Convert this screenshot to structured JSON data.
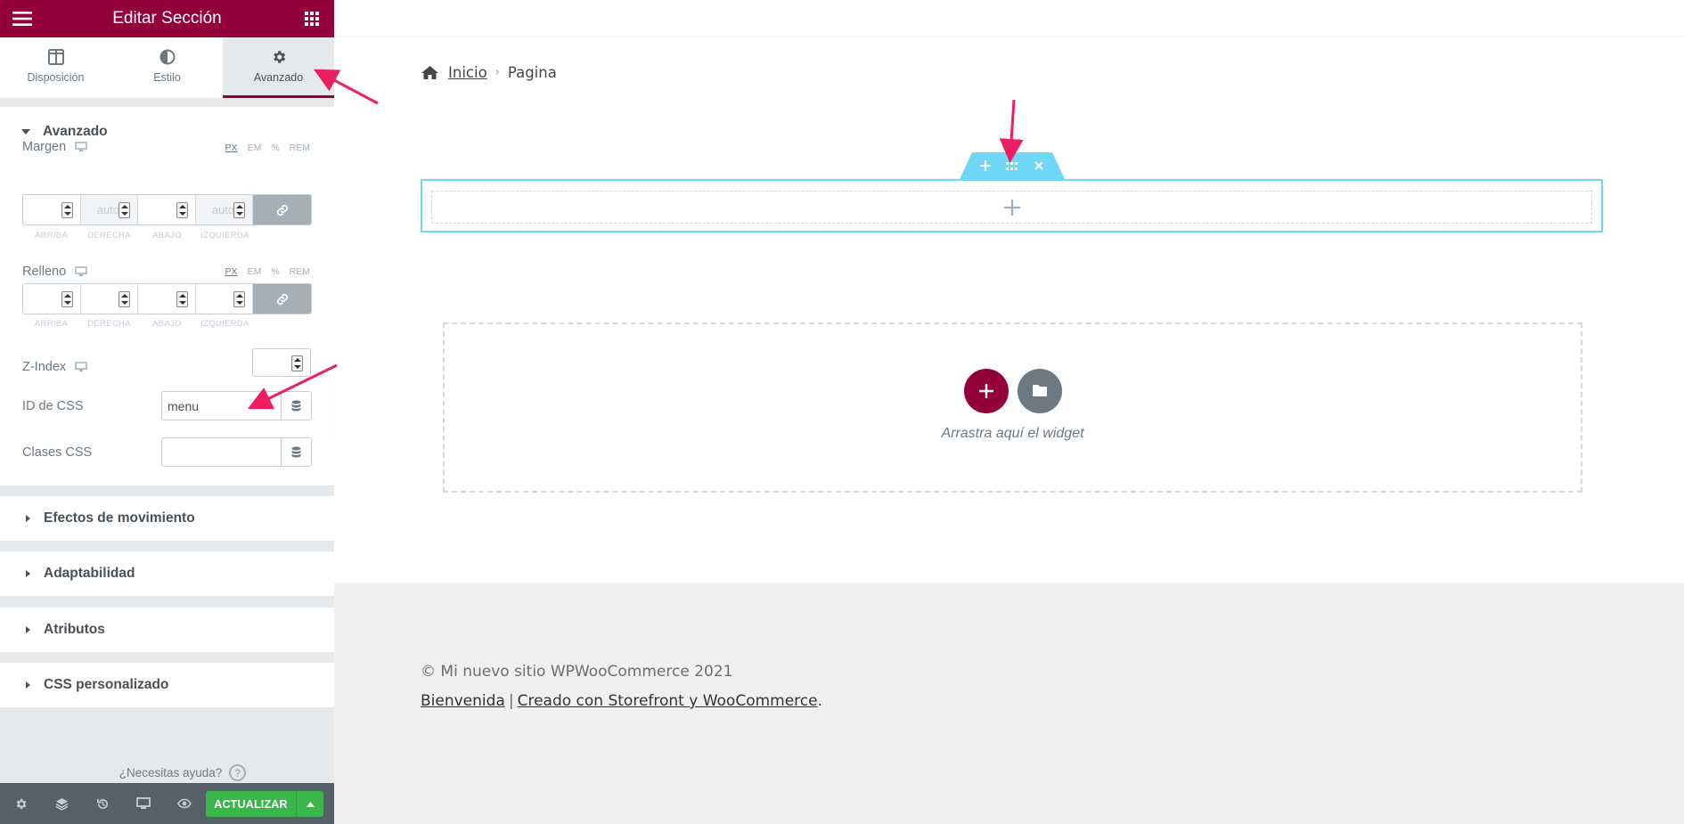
{
  "panel": {
    "title": "Editar Sección",
    "tabs": [
      {
        "label": "Disposición",
        "icon": "layout-icon"
      },
      {
        "label": "Estilo",
        "icon": "contrast-icon"
      },
      {
        "label": "Avanzado",
        "icon": "gear-icon",
        "active": true
      }
    ],
    "advanced_section": {
      "title": "Avanzado",
      "margin": {
        "label": "Margen",
        "units": [
          "PX",
          "EM",
          "%",
          "REM"
        ],
        "active_unit": "PX",
        "fields": [
          {
            "label": "ARRIBA",
            "value": "",
            "placeholder": ""
          },
          {
            "label": "DERECHA",
            "value": "",
            "placeholder": "auto",
            "disabled": true
          },
          {
            "label": "ABAJO",
            "value": "",
            "placeholder": ""
          },
          {
            "label": "IZQUIERDA",
            "value": "",
            "placeholder": "auto",
            "disabled": true
          }
        ]
      },
      "padding": {
        "label": "Relleno",
        "units": [
          "PX",
          "EM",
          "%",
          "REM"
        ],
        "active_unit": "PX",
        "fields": [
          {
            "label": "ARRIBA",
            "value": ""
          },
          {
            "label": "DERECHA",
            "value": ""
          },
          {
            "label": "ABAJO",
            "value": ""
          },
          {
            "label": "IZQUIERDA",
            "value": ""
          }
        ]
      },
      "zindex": {
        "label": "Z-Index",
        "value": ""
      },
      "css_id": {
        "label": "ID de CSS",
        "value": "menu"
      },
      "css_classes": {
        "label": "Clases CSS",
        "value": ""
      }
    },
    "collapsed_sections": [
      "Efectos de movimiento",
      "Adaptabilidad",
      "Atributos",
      "CSS personalizado"
    ],
    "help_text": "¿Necesitas ayuda?",
    "help_icon": "?",
    "footer": {
      "icons": [
        "settings-icon",
        "layers-icon",
        "history-icon",
        "responsive-icon",
        "preview-eye-icon"
      ],
      "update_label": "ACTUALIZAR"
    }
  },
  "preview": {
    "breadcrumb": {
      "home": "Inicio",
      "current": "Pagina",
      "separator": "›"
    },
    "drop_zone_text": "Arrastra aquí el widget",
    "footer": {
      "copyright": "© Mi nuevo sitio WPWooCommerce 2021",
      "link1": "Bienvenida",
      "divider": "|",
      "link2": "Creado con Storefront y WooCommerce",
      "end": "."
    }
  },
  "colors": {
    "brand": "#93003c",
    "section_outline": "#71d7f7",
    "update_button": "#39b54a",
    "annotation_arrow": "#ee1f60"
  }
}
